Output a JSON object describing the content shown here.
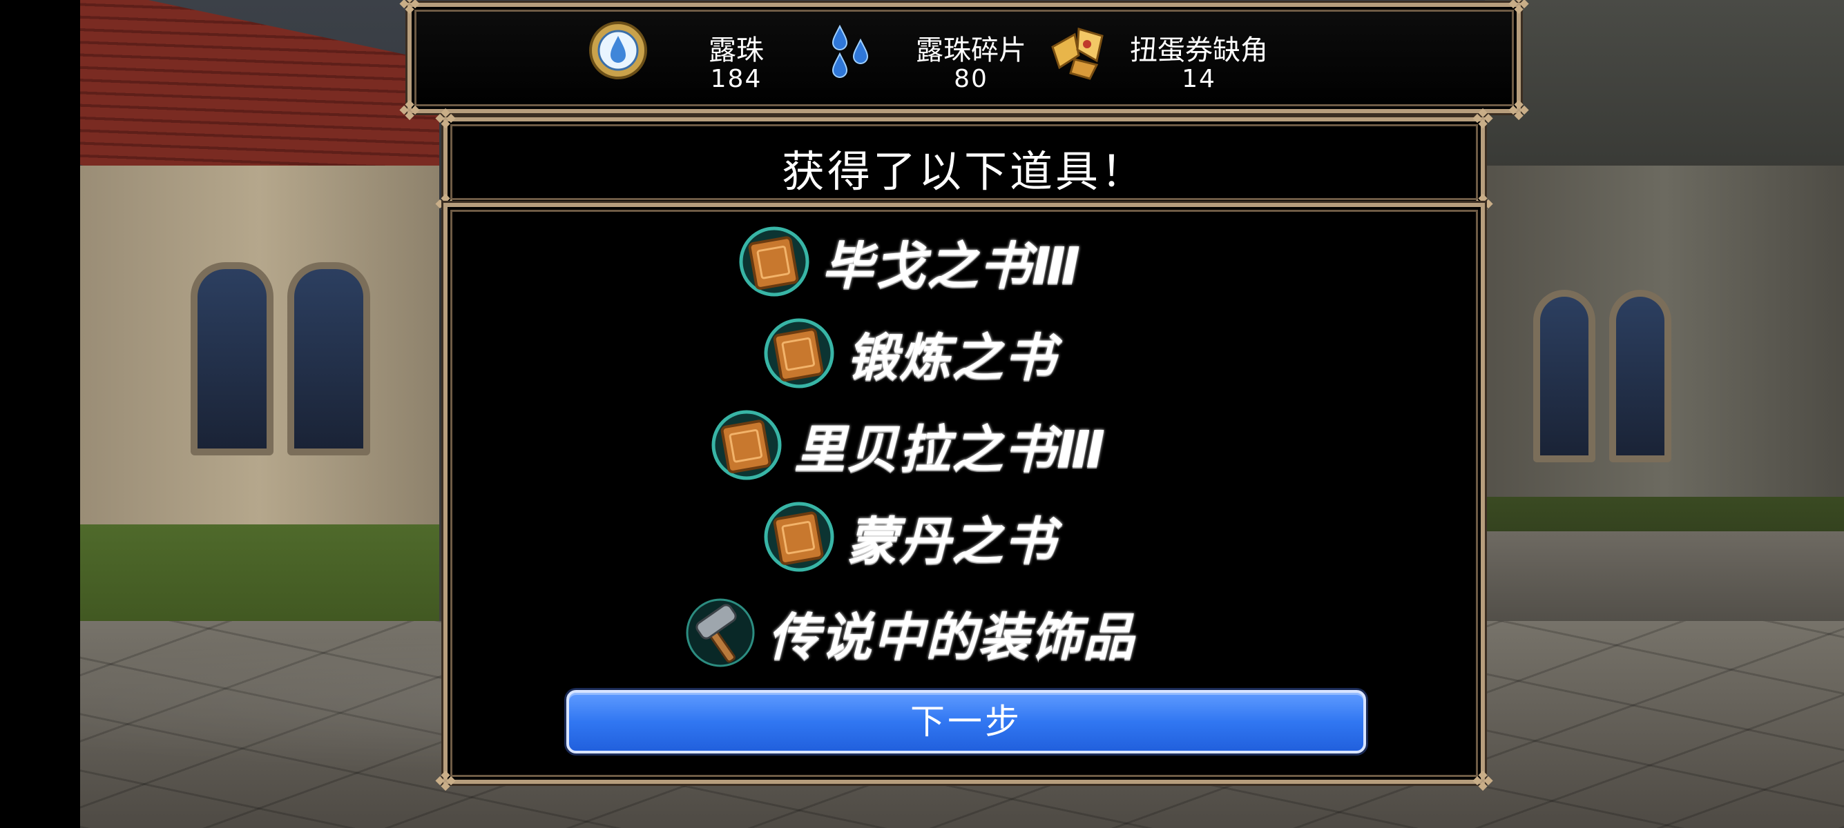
{
  "currencies": [
    {
      "name": "露珠",
      "value": "184",
      "icon": "dew-orb-icon"
    },
    {
      "name": "露珠碎片",
      "value": "80",
      "icon": "dew-shard-icon"
    },
    {
      "name": "扭蛋券缺角",
      "value": "14",
      "icon": "gacha-ticket-fragment-icon"
    }
  ],
  "dialog": {
    "title": "获得了以下道具！",
    "items": [
      {
        "label": "毕戈之书Ⅲ",
        "icon": "book-icon"
      },
      {
        "label": "锻炼之书",
        "icon": "book-icon"
      },
      {
        "label": "里贝拉之书Ⅲ",
        "icon": "book-icon"
      },
      {
        "label": "蒙丹之书",
        "icon": "book-icon"
      },
      {
        "label": "传说中的装饰品",
        "icon": "hammer-icon"
      }
    ],
    "next_label": "下一步"
  },
  "colors": {
    "frame_gold": "#b79e7d",
    "button_blue": "#3177f2",
    "icon_glow": "#3fc9b8",
    "book_orange": "#c8782e"
  }
}
